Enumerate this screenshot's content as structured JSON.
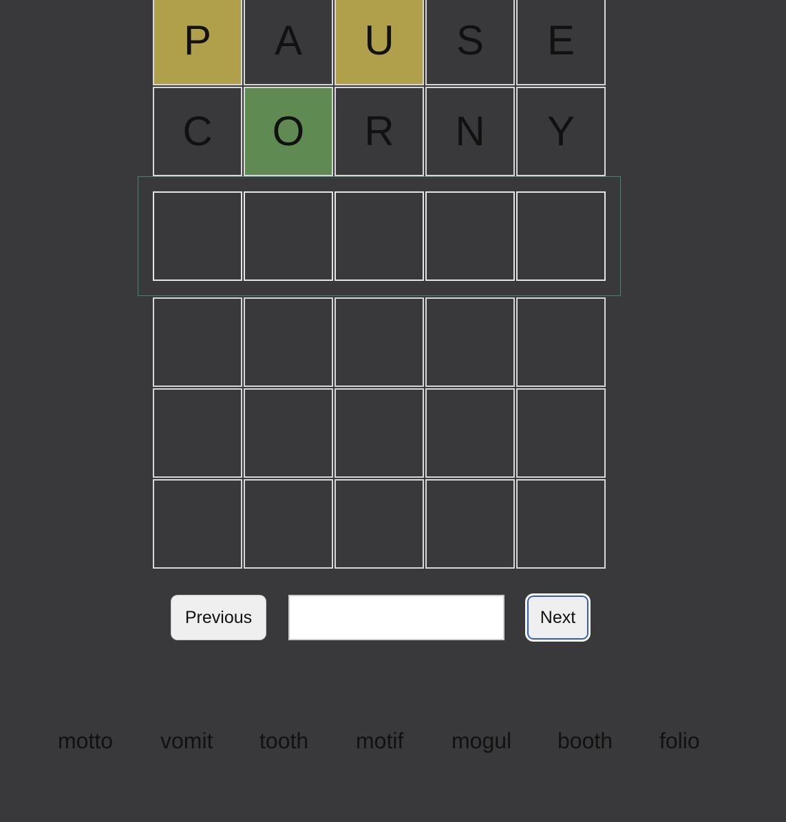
{
  "board": {
    "rows": [
      {
        "tiles": [
          {
            "letter": "P",
            "state": "present"
          },
          {
            "letter": "A",
            "state": "absent"
          },
          {
            "letter": "U",
            "state": "present"
          },
          {
            "letter": "S",
            "state": "absent"
          },
          {
            "letter": "E",
            "state": "absent"
          }
        ]
      },
      {
        "tiles": [
          {
            "letter": "C",
            "state": "absent"
          },
          {
            "letter": "O",
            "state": "correct"
          },
          {
            "letter": "R",
            "state": "absent"
          },
          {
            "letter": "N",
            "state": "absent"
          },
          {
            "letter": "Y",
            "state": "absent"
          }
        ]
      },
      {
        "active": true,
        "tiles": [
          {
            "letter": ""
          },
          {
            "letter": ""
          },
          {
            "letter": ""
          },
          {
            "letter": ""
          },
          {
            "letter": ""
          }
        ]
      },
      {
        "tiles": [
          {
            "letter": ""
          },
          {
            "letter": ""
          },
          {
            "letter": ""
          },
          {
            "letter": ""
          },
          {
            "letter": ""
          }
        ]
      },
      {
        "tiles": [
          {
            "letter": ""
          },
          {
            "letter": ""
          },
          {
            "letter": ""
          },
          {
            "letter": ""
          },
          {
            "letter": ""
          }
        ]
      },
      {
        "tiles": [
          {
            "letter": ""
          },
          {
            "letter": ""
          },
          {
            "letter": ""
          },
          {
            "letter": ""
          },
          {
            "letter": ""
          }
        ]
      }
    ]
  },
  "controls": {
    "previous_label": "Previous",
    "next_label": "Next",
    "guess_value": "",
    "guess_placeholder": ""
  },
  "words": [
    "motto",
    "vomit",
    "tooth",
    "motif",
    "mogul",
    "booth",
    "folio"
  ],
  "colors": {
    "background": "#39393b",
    "present": "#b0a04c",
    "correct": "#5f8b53",
    "tile_border": "#d8d8d8",
    "active_frame": "#3f8a6a",
    "focus_ring": "#2a5cc9"
  }
}
